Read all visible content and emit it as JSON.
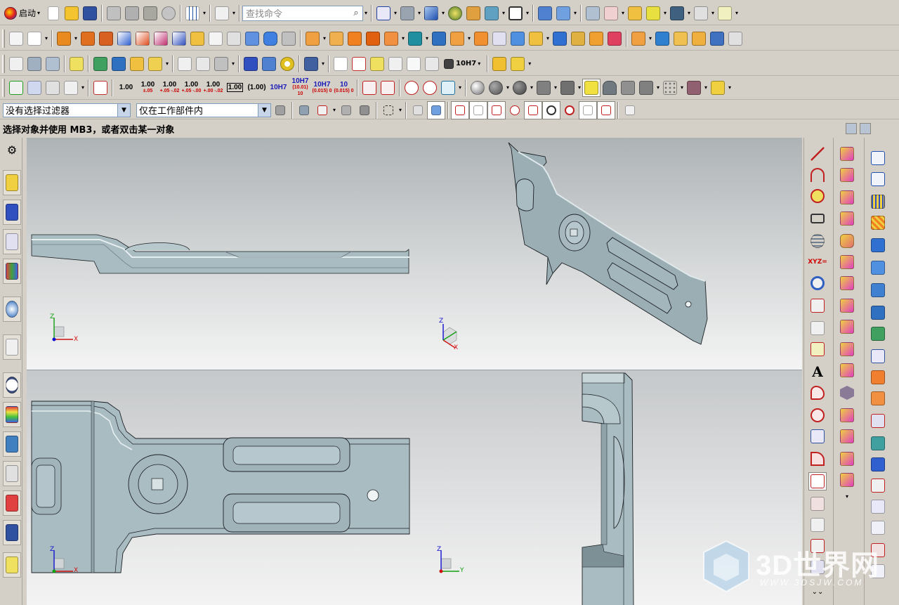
{
  "toolbar1": {
    "start_label": "启动",
    "search_placeholder": "查找命令"
  },
  "toolbar4": {
    "numbers": [
      {
        "main": "1.00",
        "sub": ""
      },
      {
        "main": "1.00",
        "sub": "±.05"
      },
      {
        "main": "1.00",
        "sub": "+.05 -.02"
      },
      {
        "main": "1.00",
        "sub": "+.05 -.00"
      },
      {
        "main": "1.00",
        "sub": "+.00 -.02"
      },
      {
        "main": "1.00",
        "sub": ""
      },
      {
        "main": "(1.00)",
        "sub": ""
      },
      {
        "main": "10H7",
        "sub": ""
      },
      {
        "main": "10H7",
        "sub": "(10.01) 10"
      },
      {
        "main": "10H7",
        "sub": "(0.015) 0"
      },
      {
        "main": "10",
        "sub": "(0.015) 0"
      }
    ],
    "fit_label": "10H7"
  },
  "selection_bar": {
    "filter_value": "没有选择过滤器",
    "scope_value": "仅在工作部件内"
  },
  "status": {
    "prompt": "选择对象并使用 MB3，或者双击某一对象"
  },
  "viewport": {
    "triad_labels": {
      "x": "X",
      "y": "Y",
      "z": "Z"
    },
    "text_tool_label": "A",
    "xyz_tool_label": "XYZ="
  },
  "watermark": {
    "title": "3D世界网",
    "url": "WWW.3DSJW.COM"
  },
  "colors": {
    "part_fill": "#a9bcc2",
    "part_edge": "#1c2024",
    "toolbar_bg": "#d4d0c8",
    "axis_x": "#d01010",
    "axis_y": "#10a010",
    "axis_z": "#1010d0"
  }
}
